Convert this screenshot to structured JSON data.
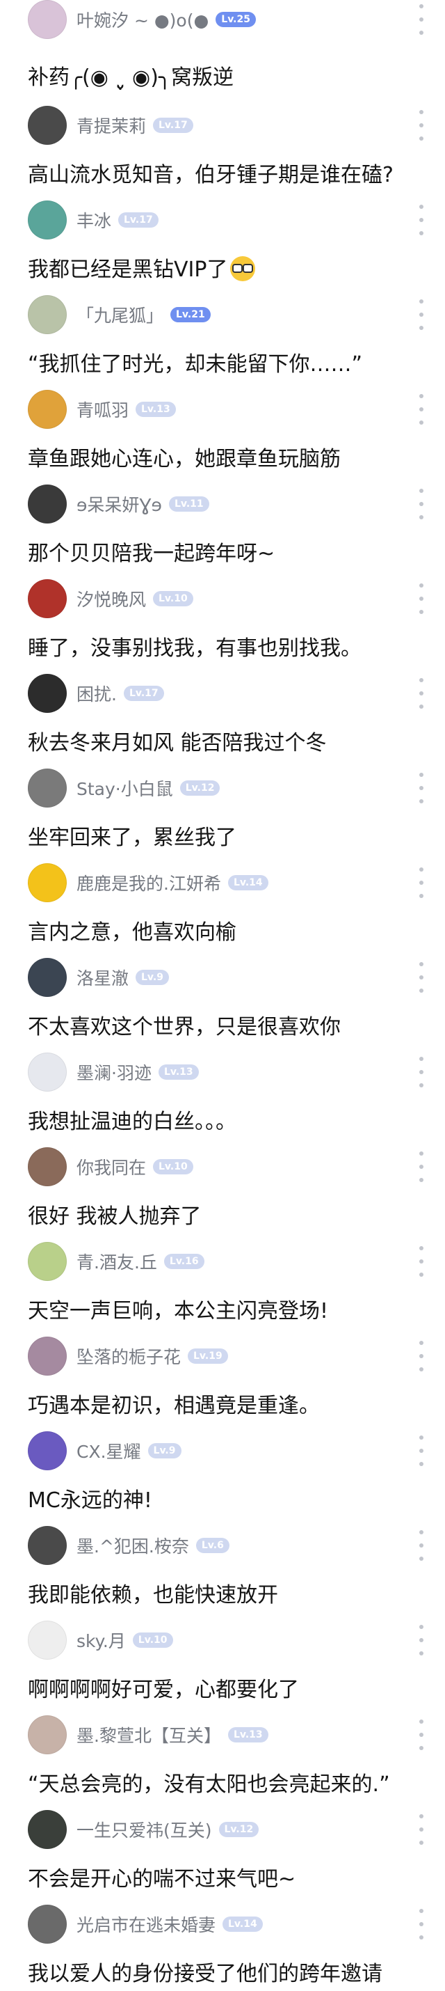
{
  "posts": [
    {
      "name": "叶婉汐 ~ ●)o(●",
      "level": "Lv.25",
      "content": "补药╭(◉ ˬ̮ ◉)╮窝叛逆",
      "avatar_color": "#d9c3d8",
      "top_level": true
    },
    {
      "name": "青提茉莉",
      "level": "Lv.17",
      "content": "高山流水觅知音，伯牙锺子期是谁在磕?",
      "avatar_color": "#4a4a4a"
    },
    {
      "name": "丰冰",
      "level": "Lv.17",
      "content": "我都已经是黑钻VIP了",
      "avatar_color": "#5aa59a",
      "emoji": "nerd-face"
    },
    {
      "name": "「九尾狐」",
      "level": "Lv.21",
      "content": "“我抓住了时光，却未能留下你……”",
      "avatar_color": "#b9c3a8",
      "top_level": true
    },
    {
      "name": "青呱羽",
      "level": "Lv.13",
      "content": "章鱼跟她心连心，她跟章鱼玩脑筋",
      "avatar_color": "#e0a23a"
    },
    {
      "name": "ɘ呆呆妍Ɣɘ",
      "level": "Lv.11",
      "content": "那个贝贝陪我一起跨年呀~",
      "avatar_color": "#3a3a3a"
    },
    {
      "name": "汐悦晚风",
      "level": "Lv.10",
      "content": "睡了，没事别找我，有事也别找我。",
      "avatar_color": "#b0322a"
    },
    {
      "name": "困扰.",
      "level": "Lv.17",
      "content": "秋去冬来月如风 能否陪我过个冬",
      "avatar_color": "#2c2c2c"
    },
    {
      "name": "Stay·小白鼠",
      "level": "Lv.12",
      "content": "坐牢回来了，累丝我了",
      "avatar_color": "#7a7a7a"
    },
    {
      "name": "鹿鹿是我的.江妍希",
      "level": "Lv.14",
      "content": "言内之意，他喜欢向榆",
      "avatar_color": "#f3c21a"
    },
    {
      "name": "洛星澈",
      "level": "Lv.9",
      "content": "不太喜欢这个世界，只是很喜欢你",
      "avatar_color": "#3b4552"
    },
    {
      "name": "墨澜·羽迹",
      "level": "Lv.13",
      "content": "我想扯温迪的白丝。。。",
      "avatar_color": "#e6e8ee"
    },
    {
      "name": "你我同在",
      "level": "Lv.10",
      "content": "很好 我被人抛弃了",
      "avatar_color": "#8a6a5a"
    },
    {
      "name": "青.酒友.丘",
      "level": "Lv.16",
      "content": "天空一声巨响，本公主闪亮登场!",
      "avatar_color": "#b9d08a"
    },
    {
      "name": "坠落的栀子花",
      "level": "Lv.19",
      "content": "巧遇本是初识，相遇竟是重逢。",
      "avatar_color": "#a58aa0"
    },
    {
      "name": "CX.星耀",
      "level": "Lv.9",
      "content": "MC永远的神!",
      "avatar_color": "#6a5ac0"
    },
    {
      "name": "墨.^犯困.桉奈",
      "level": "Lv.6",
      "content": "我即能依赖，也能快速放开",
      "avatar_color": "#4a4a4a"
    },
    {
      "name": "sky.月",
      "level": "Lv.10",
      "content": "啊啊啊啊好可爱，心都要化了",
      "avatar_color": "#eeeeee"
    },
    {
      "name": "墨.黎萱北【互关】",
      "level": "Lv.13",
      "content": "“天总会亮的，没有太阳也会亮起来的.”",
      "avatar_color": "#c7b2a8"
    },
    {
      "name": "一生只爱祎(互关)",
      "level": "Lv.12",
      "content": "不会是开心的喘不过来气吧~",
      "avatar_color": "#3a3f3a"
    },
    {
      "name": "光启市在逃未婚妻",
      "level": "Lv.14",
      "content": "我以爱人的身份接受了他们的跨年邀请",
      "avatar_color": "#6a6a6a"
    }
  ],
  "icons": {
    "more": "more-vertical-icon"
  }
}
